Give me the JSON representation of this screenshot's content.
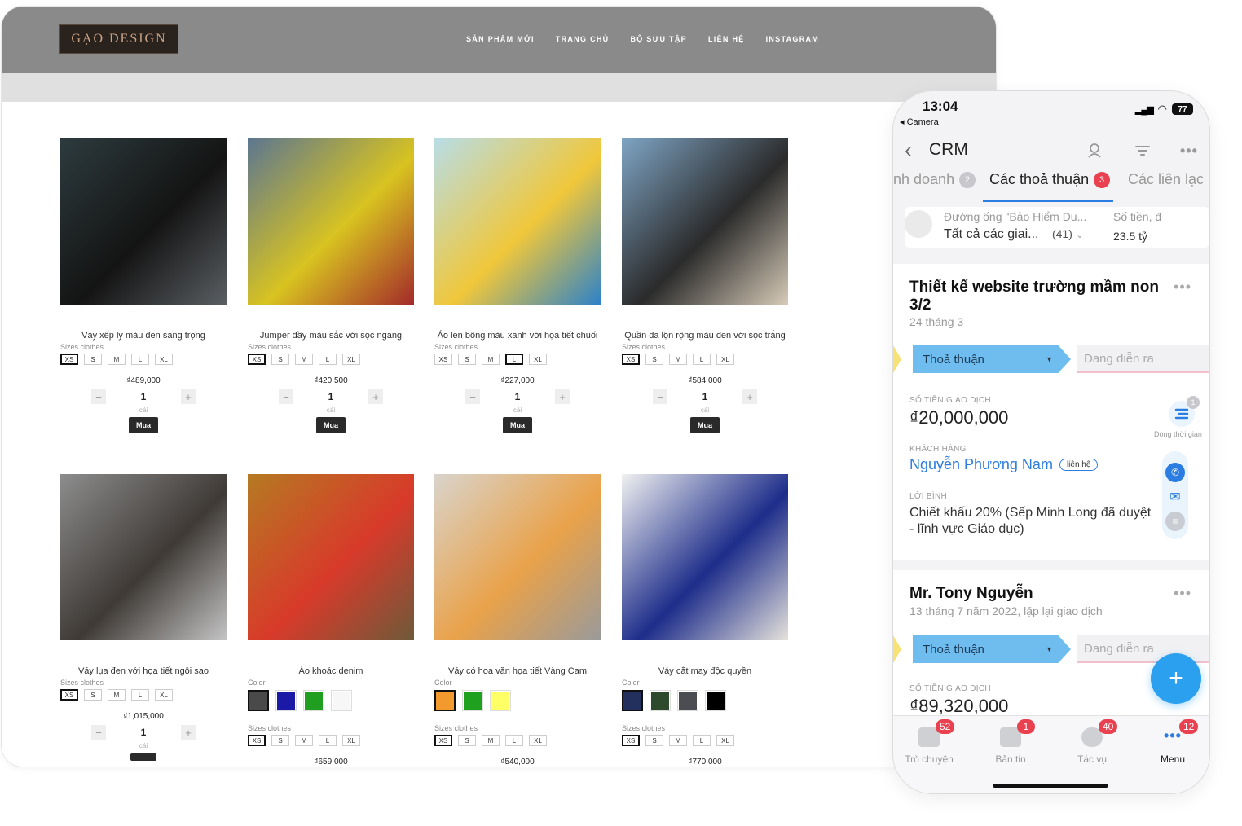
{
  "website": {
    "logo": "GẠO DESIGN",
    "nav": [
      "SẢN PHẨM MỚI",
      "TRANG CHỦ",
      "BỘ SƯU TẬP",
      "LIÊN HỆ",
      "INSTAGRAM"
    ],
    "products": [
      {
        "name": "Váy xếp ly màu đen sang trọng",
        "photo": [
          "#2d3b3e",
          "#141414",
          "#5a5f63"
        ],
        "label": "Sizes clothes",
        "sizes": [
          "XS",
          "S",
          "M",
          "L",
          "XL"
        ],
        "selected_size": "XS",
        "price": "₫489,000",
        "qty": "1",
        "unit": "cái",
        "buy": "Mua"
      },
      {
        "name": "Jumper đầy màu sắc với sọc ngang",
        "photo": [
          "#5c7690",
          "#d8c320",
          "#a32a2a"
        ],
        "label": "Sizes clothes",
        "sizes": [
          "XS",
          "S",
          "M",
          "L",
          "XL"
        ],
        "selected_size": "XS",
        "price": "₫420,500",
        "qty": "1",
        "unit": "cái",
        "buy": "Mua"
      },
      {
        "name": "Áo len bông màu xanh với họa tiết chuối",
        "photo": [
          "#b8dde6",
          "#f0c73a",
          "#2c82c9"
        ],
        "label": "Sizes clothes",
        "sizes": [
          "XS",
          "S",
          "M",
          "L",
          "XL"
        ],
        "selected_size": "L",
        "price": "₫227,000",
        "qty": "1",
        "unit": "cái",
        "buy": "Mua"
      },
      {
        "name": "Quần da lộn rộng màu đen với sọc trắng",
        "photo": [
          "#7ea4c4",
          "#2b2b2b",
          "#d7cbb8"
        ],
        "label": "Sizes clothes",
        "sizes": [
          "XS",
          "S",
          "M",
          "L",
          "XL"
        ],
        "selected_size": "XS",
        "price": "₫584,000",
        "qty": "1",
        "unit": "cái",
        "buy": "Mua"
      },
      {
        "name": "Váy lụa đen với họa tiết ngôi sao",
        "photo": [
          "#8d8d8d",
          "#3f3a36",
          "#c4c4c4"
        ],
        "label": "Sizes clothes",
        "sizes": [
          "XS",
          "S",
          "M",
          "L",
          "XL"
        ],
        "selected_size": "XS",
        "price": "₫1,015,000",
        "qty": "1",
        "unit": "cái",
        "buy": ""
      },
      {
        "name": "Áo khoác denim",
        "photo": [
          "#b57a22",
          "#d83a2a",
          "#6e5a3a"
        ],
        "colors_label": "Color",
        "colors": [
          "#4a4a4a",
          "#1a1aa6",
          "#1f9e1f",
          "#f7f7f7"
        ],
        "selected_color": 0,
        "label": "Sizes clothes",
        "sizes": [
          "XS",
          "S",
          "M",
          "L",
          "XL"
        ],
        "selected_size": "XS",
        "price": "₫659,000"
      },
      {
        "name": "Váy có hoa văn họa tiết Vàng Cam",
        "photo": [
          "#d9d4cc",
          "#e9a24a",
          "#9a9a9a"
        ],
        "colors_label": "Color",
        "colors": [
          "#f29a2e",
          "#1fa01f",
          "#ffff66"
        ],
        "selected_color": 0,
        "label": "Sizes clothes",
        "sizes": [
          "XS",
          "S",
          "M",
          "L",
          "XL"
        ],
        "selected_size": "XS",
        "price": "₫540,000"
      },
      {
        "name": "Váy cắt may độc quyền",
        "photo": [
          "#f1f1f1",
          "#1d2d8a",
          "#e6e2dc"
        ],
        "colors_label": "Color",
        "colors": [
          "#23305e",
          "#2d4a2d",
          "#4b4d52",
          "#000000"
        ],
        "selected_color": 0,
        "label": "Sizes clothes",
        "sizes": [
          "XS",
          "S",
          "M",
          "L",
          "XL"
        ],
        "selected_size": "XS",
        "price": "₫770,000"
      }
    ]
  },
  "phone": {
    "status": {
      "time": "13:04",
      "back_app": "◂ Camera",
      "battery": "77"
    },
    "header": {
      "back_icon": "‹",
      "title": "CRM",
      "icons": [
        "search-person-icon",
        "filter-icon",
        "more-icon"
      ]
    },
    "tabs": [
      {
        "label": "nh doanh",
        "count": "2"
      },
      {
        "label": "Các thoả thuận",
        "count": "3",
        "active": true
      },
      {
        "label": "Các liên lạc",
        "count": ""
      }
    ],
    "pipeline": {
      "line1": "Đường ống \"Bảo Hiểm Du...",
      "line2": "Tất cả các giai...",
      "count": "(41)",
      "amount_label": "Số tiền, đ",
      "amount": "23.5 tỷ"
    },
    "deals": [
      {
        "title": "Thiết kế website trường mầm non 3/2",
        "date": "24 tháng 3",
        "stage": "Thoả thuận",
        "next_stage": "Đang diễn ra",
        "amount_label": "SỐ TIỀN GIAO DỊCH",
        "amount": "₫20,000,000",
        "timeline_label": "Dòng thời gian",
        "timeline_badge": "1",
        "customer_label": "KHÁCH HÀNG",
        "customer": "Nguyễn Phương Nam",
        "customer_tag": "liên hệ",
        "comment_label": "LỜI BÌNH",
        "comment": "Chiết khấu 20% (Sếp Minh Long đã duyệt - lĩnh vực Giáo dục)"
      },
      {
        "title": "Mr. Tony Nguyễn",
        "date": "13  tháng 7 năm 2022, lặp lại giao dịch",
        "stage": "Thoả thuận",
        "next_stage": "Đang diễn ra",
        "amount_label": "SỐ TIỀN GIAO DỊCH",
        "amount": "₫89,320,000"
      }
    ],
    "fab": "+",
    "bottom_nav": [
      {
        "label": "Trò chuyện",
        "badge": "52"
      },
      {
        "label": "Bản tin",
        "badge": "1"
      },
      {
        "label": "Tác vụ",
        "badge": "40"
      },
      {
        "label": "Menu",
        "badge": "12",
        "active": true
      }
    ],
    "colors": {
      "accent": "#2b7de1",
      "badge": "#e9414f",
      "stage": "#6fbcef",
      "fab": "#2ba0ef"
    }
  }
}
